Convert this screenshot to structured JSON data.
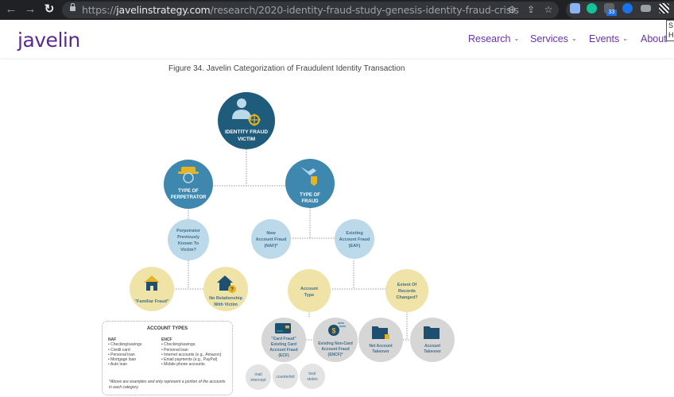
{
  "browser": {
    "url_prefix": "https://",
    "url_domain": "javelinstrategy.com",
    "url_path": "/research/2020-identity-fraud-study-genesis-identity-fraud-crisis",
    "nav_icons": [
      "back-icon",
      "forward-icon",
      "reload-icon"
    ],
    "omnibox_icons": [
      "zoom-icon",
      "share-icon",
      "bookmark-star-icon"
    ],
    "extensions": [
      {
        "name": "puzzle-extension-icon",
        "color": "#8ab4f8"
      },
      {
        "name": "grammarly-extension-icon",
        "color": "#15c39a"
      },
      {
        "name": "mail-extension-icon",
        "color": "#5f6368"
      },
      {
        "name": "play-extension-icon",
        "color": "#1a73e8"
      },
      {
        "name": "link-extension-icon",
        "color": "#9aa0a6"
      },
      {
        "name": "pattern-extension-icon",
        "color": "#e8eaed"
      }
    ],
    "mail_badge": "33",
    "tooltip_text": "S H"
  },
  "site": {
    "logo": "javelin",
    "brand_color": "#5b2a91",
    "nav": [
      {
        "label": "Research"
      },
      {
        "label": "Services"
      },
      {
        "label": "Events"
      },
      {
        "label": "About"
      }
    ],
    "chevron": "⌄"
  },
  "figure": {
    "caption": "Figure 34. Javelin Categorization of Fraudulent Identity Transaction",
    "colors": {
      "dark_blue": "#1f5b7a",
      "mid_blue": "#3e87ae",
      "light_blue": "#bcd9ea",
      "tan": "#efe3a8",
      "gray": "#d6d6d6",
      "icon_yellow": "#e6b422",
      "icon_navy": "#1e4f6e"
    },
    "nodes": {
      "root": {
        "line1": "IDENTITY FRAUD",
        "line2": "VICTIM",
        "icon": "person-target-icon"
      },
      "perpetrator": {
        "line1": "TYPE OF",
        "line2": "PERPETRATOR",
        "icon": "hat-face-icon"
      },
      "fraud_type": {
        "line1": "TYPE OF",
        "line2": "FRAUD",
        "icon": "hand-bag-icon"
      },
      "known": {
        "lines": [
          "Perpetrator",
          "Previously",
          "Known To",
          "Victim?"
        ]
      },
      "naf": {
        "lines": [
          "New",
          "Account Fraud",
          "(NAF)*"
        ]
      },
      "eaf": {
        "lines": [
          "Existing",
          "Account Fraud",
          "(EAF)"
        ]
      },
      "familiar": {
        "lines": [
          "\"Familiar Fraud\""
        ],
        "icon": "house-icon"
      },
      "no_relationship": {
        "lines": [
          "No Relationship",
          "With Victim"
        ],
        "icon": "house-question-icon"
      },
      "account_type": {
        "lines": [
          "Account",
          "Type"
        ]
      },
      "extent": {
        "lines": [
          "Extent Of",
          "Records",
          "Changed?"
        ]
      },
      "ecf": {
        "lines": [
          "\"Card Fraud\"",
          "Existing Card",
          "Account Fraud",
          "(ECF)"
        ],
        "icon": "credit-card-icon"
      },
      "encf": {
        "lines": [
          "Existing Non-Card",
          "Account Fraud",
          "(ENCF)*"
        ],
        "icon": "dollar-coin-icon"
      },
      "nat": {
        "lines": [
          "Net Account",
          "Takeover"
        ],
        "icon": "folder-lock-icon"
      },
      "at": {
        "lines": [
          "Account",
          "Takeover"
        ],
        "icon": "folder-icon"
      },
      "mail": {
        "lines": [
          "mail",
          "intercept"
        ]
      },
      "counterfeit": {
        "lines": [
          "counterfeit"
        ]
      },
      "lost": {
        "lines": [
          "lost/",
          "stolen"
        ]
      }
    },
    "account_types": {
      "title": "ACCOUNT TYPES",
      "naf_header": "NAF",
      "naf_items": [
        "Checking/savings",
        "Credit card",
        "Personal loan",
        "Mortgage loan",
        "Auto loan"
      ],
      "encf_header": "ENCF",
      "encf_items": [
        "Checking/savings",
        "Personal loan",
        "Internet accounts (e.g., Amazon)",
        "Email payments (e.g., PayPal)",
        "Mobile phone accounts"
      ],
      "note": "*Above are examples and only represent a portion of the accounts in each category."
    }
  }
}
